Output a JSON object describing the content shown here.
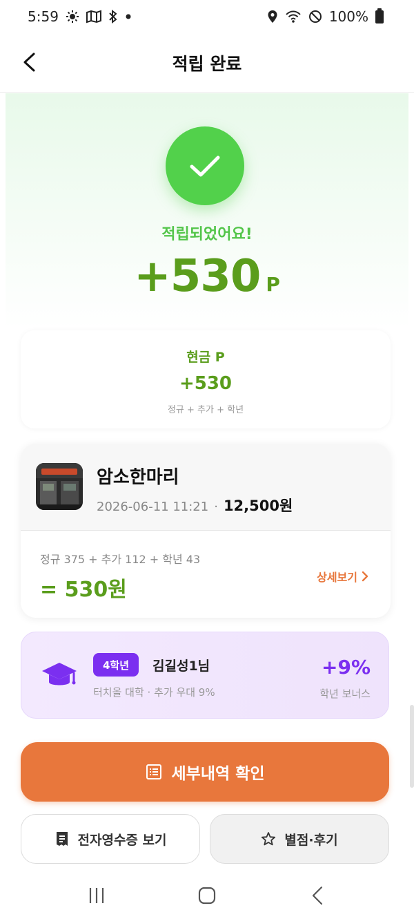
{
  "status_bar": {
    "time": "5:59",
    "battery": "100%"
  },
  "header": {
    "title": "적립 완료"
  },
  "hero": {
    "message": "적립되었어요!",
    "amount": "+530",
    "unit": "P"
  },
  "cash": {
    "label": "현금 P",
    "value": "+530",
    "formula": "정규 + 추가 + 학년"
  },
  "store": {
    "name": "암소한마리",
    "datetime": "2026-06-11 11:21",
    "separator": "·",
    "price": "12,500원",
    "calc_formula": "정규 375 + 추가 112 + 학년 43",
    "calc_total": "= 530원",
    "detail_label": "상세보기"
  },
  "grade": {
    "badge": "4학년",
    "name": "김길성1님",
    "desc": "터치올 대학 · 추가 우대 9%",
    "bonus": "+9%",
    "bonus_label": "학년 보너스"
  },
  "actions": {
    "primary_label": "세부내역 확인",
    "receipt_label": "전자영수증 보기",
    "review_label": "별점·후기"
  },
  "colors": {
    "green": "#5a9d1c",
    "check_green": "#52d14b",
    "orange": "#e8773c",
    "purple": "#7b2ff0"
  },
  "icons": {
    "back": "chevron-left-icon",
    "check": "check-icon",
    "graduation": "graduation-cap-icon",
    "list": "list-icon",
    "receipt": "receipt-icon",
    "star": "star-icon"
  }
}
